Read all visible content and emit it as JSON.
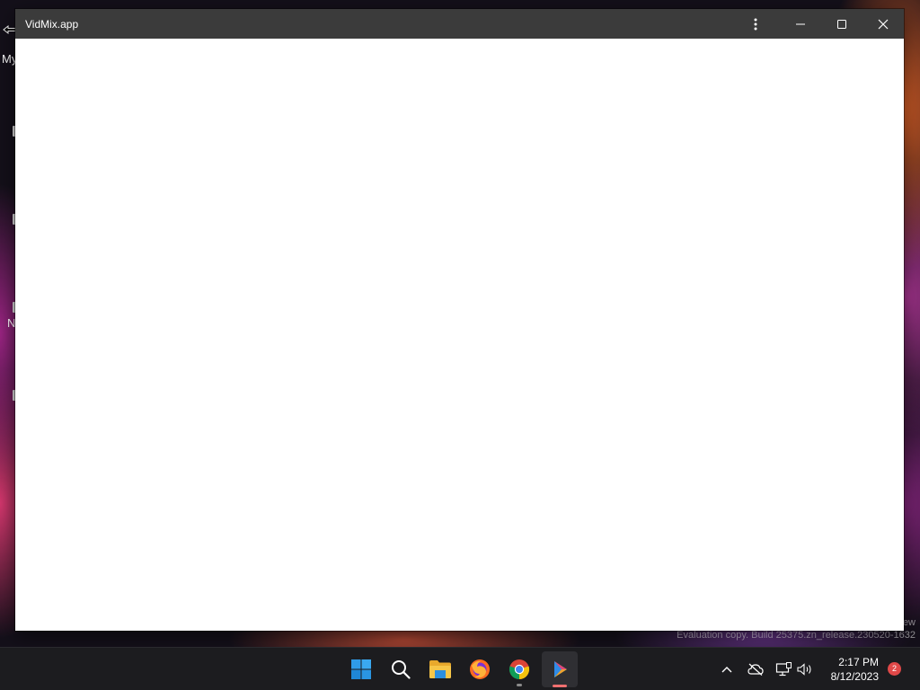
{
  "desktop": {
    "labels": [
      "My",
      "N"
    ]
  },
  "window": {
    "title": "VidMix.app",
    "menu_icon": "more-vertical-icon",
    "minimize_icon": "minimize-icon",
    "maximize_icon": "maximize-icon",
    "close_icon": "close-icon"
  },
  "watermark": {
    "line1": "ew",
    "line2": "Evaluation copy. Build 25375.zn_release.230520-1632"
  },
  "taskbar": {
    "apps": [
      {
        "name": "start",
        "icon": "windows-start-icon"
      },
      {
        "name": "search",
        "icon": "search-icon"
      },
      {
        "name": "file-explorer",
        "icon": "folder-icon"
      },
      {
        "name": "firefox",
        "icon": "firefox-icon"
      },
      {
        "name": "chrome",
        "icon": "chrome-icon"
      },
      {
        "name": "vidmix",
        "icon": "play-icon"
      }
    ],
    "tray": {
      "overflow_icon": "chevron-up-icon",
      "cloud_icon": "cloud-offline-icon",
      "network_icon": "network-icon",
      "volume_icon": "volume-icon"
    },
    "clock": {
      "time": "2:17 PM",
      "date": "8/12/2023"
    },
    "notification_count": "2"
  },
  "colors": {
    "titlebar": "#3b3b3b",
    "taskbar": "#1c1c1f",
    "window_content": "#ffffff",
    "notification": "#e04848"
  }
}
